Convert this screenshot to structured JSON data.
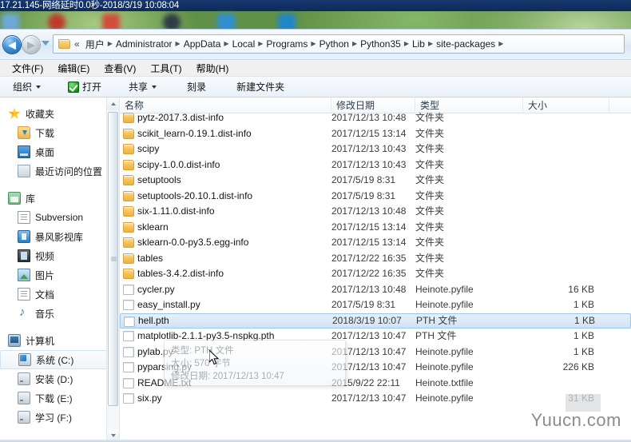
{
  "window": {
    "title_bar": "17.21.145-网络延时0.0秒-2018/3/19 10:08:04"
  },
  "address_bar": {
    "back_glyph": "◀",
    "forward_glyph": "▶",
    "double_chevron": "«",
    "crumbs": [
      "用户",
      "Administrator",
      "AppData",
      "Local",
      "Programs",
      "Python",
      "Python35",
      "Lib",
      "site-packages"
    ],
    "separator": "▶"
  },
  "menu": {
    "items": [
      "文件(F)",
      "编辑(E)",
      "查看(V)",
      "工具(T)",
      "帮助(H)"
    ]
  },
  "toolbar": {
    "organize": "组织",
    "open": "打开",
    "share": "共享",
    "burn": "刻录",
    "new_folder": "新建文件夹"
  },
  "nav_pane": {
    "groups": [
      {
        "header": {
          "label": "收藏夹",
          "icon": "star-icon",
          "icon_class": "ic-star"
        },
        "items": [
          {
            "label": "下载",
            "icon": "downloads-icon",
            "icon_class": "ic-dl"
          },
          {
            "label": "桌面",
            "icon": "desktop-icon",
            "icon_class": "ic-desk"
          },
          {
            "label": "最近访问的位置",
            "icon": "recent-places-icon",
            "icon_class": "ic-recent"
          }
        ]
      },
      {
        "header": {
          "label": "库",
          "icon": "library-icon",
          "icon_class": "ic-lib"
        },
        "items": [
          {
            "label": "Subversion",
            "icon": "subversion-icon",
            "icon_class": "ic-doc"
          },
          {
            "label": "暴风影视库",
            "icon": "baofeng-library-icon",
            "icon_class": "ic-media"
          },
          {
            "label": "视频",
            "icon": "videos-icon",
            "icon_class": "ic-video"
          },
          {
            "label": "图片",
            "icon": "pictures-icon",
            "icon_class": "ic-pic"
          },
          {
            "label": "文档",
            "icon": "documents-icon",
            "icon_class": "ic-doc"
          },
          {
            "label": "音乐",
            "icon": "music-icon",
            "icon_class": "ic-music"
          }
        ]
      },
      {
        "header": {
          "label": "计算机",
          "icon": "computer-icon",
          "icon_class": "ic-pc"
        },
        "items": [
          {
            "label": "系统 (C:)",
            "icon": "drive-c-icon",
            "icon_class": "ic-drvc",
            "selected": true
          },
          {
            "label": "安装 (D:)",
            "icon": "drive-d-icon",
            "icon_class": "ic-drv"
          },
          {
            "label": "下载 (E:)",
            "icon": "drive-e-icon",
            "icon_class": "ic-drv"
          },
          {
            "label": "学习 (F:)",
            "icon": "drive-f-icon",
            "icon_class": "ic-drv"
          }
        ]
      }
    ]
  },
  "file_list": {
    "columns": [
      {
        "key": "name",
        "label": "名称"
      },
      {
        "key": "date",
        "label": "修改日期"
      },
      {
        "key": "type",
        "label": "类型"
      },
      {
        "key": "size",
        "label": "大小"
      }
    ],
    "rows": [
      {
        "name": "pytz-2017.3.dist-info",
        "date": "2017/12/13 10:48",
        "type": "文件夹",
        "size": "",
        "kind": "folder"
      },
      {
        "name": "scikit_learn-0.19.1.dist-info",
        "date": "2017/12/15 13:14",
        "type": "文件夹",
        "size": "",
        "kind": "folder"
      },
      {
        "name": "scipy",
        "date": "2017/12/13 10:43",
        "type": "文件夹",
        "size": "",
        "kind": "folder"
      },
      {
        "name": "scipy-1.0.0.dist-info",
        "date": "2017/12/13 10:43",
        "type": "文件夹",
        "size": "",
        "kind": "folder"
      },
      {
        "name": "setuptools",
        "date": "2017/5/19 8:31",
        "type": "文件夹",
        "size": "",
        "kind": "folder"
      },
      {
        "name": "setuptools-20.10.1.dist-info",
        "date": "2017/5/19 8:31",
        "type": "文件夹",
        "size": "",
        "kind": "folder"
      },
      {
        "name": "six-1.11.0.dist-info",
        "date": "2017/12/13 10:48",
        "type": "文件夹",
        "size": "",
        "kind": "folder"
      },
      {
        "name": "sklearn",
        "date": "2017/12/15 13:14",
        "type": "文件夹",
        "size": "",
        "kind": "folder"
      },
      {
        "name": "sklearn-0.0-py3.5.egg-info",
        "date": "2017/12/15 13:14",
        "type": "文件夹",
        "size": "",
        "kind": "folder"
      },
      {
        "name": "tables",
        "date": "2017/12/22 16:35",
        "type": "文件夹",
        "size": "",
        "kind": "folder"
      },
      {
        "name": "tables-3.4.2.dist-info",
        "date": "2017/12/22 16:35",
        "type": "文件夹",
        "size": "",
        "kind": "folder"
      },
      {
        "name": "cycler.py",
        "date": "2017/12/13 10:48",
        "type": "Heinote.pyfile",
        "size": "16 KB",
        "kind": "file"
      },
      {
        "name": "easy_install.py",
        "date": "2017/5/19 8:31",
        "type": "Heinote.pyfile",
        "size": "1 KB",
        "kind": "file"
      },
      {
        "name": "hell.pth",
        "date": "2018/3/19 10:07",
        "type": "PTH 文件",
        "size": "1 KB",
        "kind": "file",
        "selected": true
      },
      {
        "name": "matplotlib-2.1.1-py3.5-nspkg.pth",
        "date": "2017/12/13 10:47",
        "type": "PTH 文件",
        "size": "1 KB",
        "kind": "file"
      },
      {
        "name": "pylab.py",
        "date": "2017/12/13 10:47",
        "type": "Heinote.pyfile",
        "size": "1 KB",
        "kind": "file"
      },
      {
        "name": "pyparsing.py",
        "date": "2017/12/13 10:47",
        "type": "Heinote.pyfile",
        "size": "226 KB",
        "kind": "file"
      },
      {
        "name": "README.txt",
        "date": "2015/9/22 22:11",
        "type": "Heinote.txtfile",
        "size": "",
        "kind": "file"
      },
      {
        "name": "six.py",
        "date": "2017/12/13 10:47",
        "type": "Heinote.pyfile",
        "size": "31 KB",
        "kind": "file"
      }
    ]
  },
  "tooltip": {
    "type_line": "类型: PTH 文件",
    "size_line": "大小: 570 字节",
    "date_line": "修改日期: 2017/12/13 10:47"
  },
  "watermark": {
    "text": "Yuucn.com"
  },
  "colors": {
    "selection_border": "#9cc6ea",
    "selection_fill": "#cfe3f7",
    "folder_icon": "#f6c45c",
    "title_bar": "#17386e"
  }
}
